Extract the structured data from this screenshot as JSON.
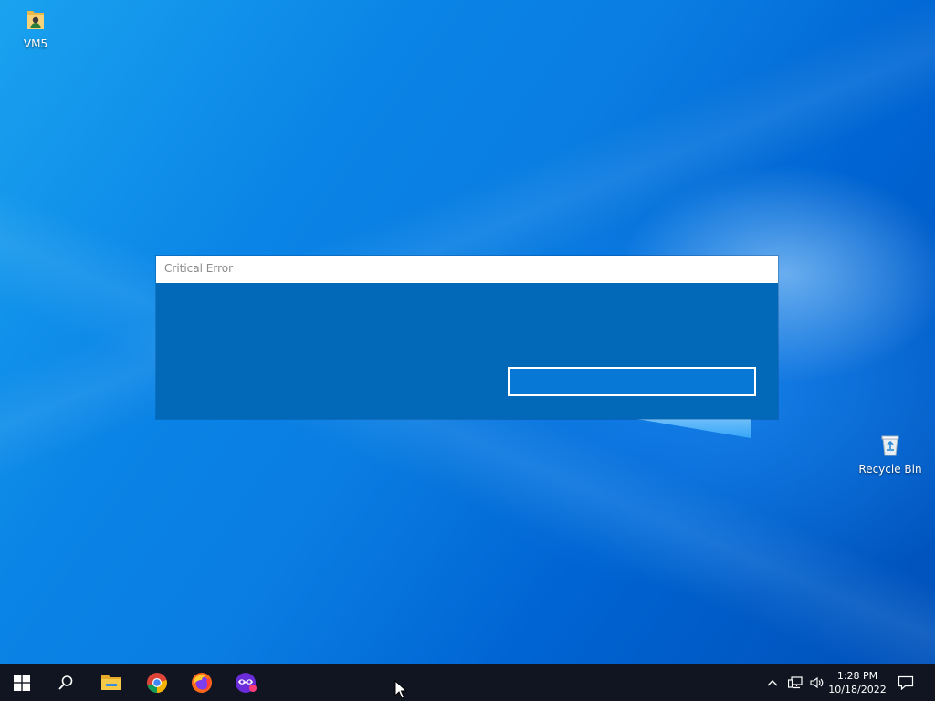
{
  "desktop": {
    "icons": [
      {
        "label": "VM5",
        "icon": "user-folder-icon"
      },
      {
        "label": "Recycle Bin",
        "icon": "recycle-bin-icon"
      }
    ]
  },
  "dialog": {
    "title": "Critical Error",
    "button_label": ""
  },
  "taskbar": {
    "items": [
      "start-icon",
      "search-icon",
      "file-explorer-icon",
      "chrome-icon",
      "firefox-icon",
      "app-icon"
    ],
    "tray": {
      "time": "1:28 PM",
      "date": "10/18/2022"
    }
  },
  "colors": {
    "taskbar": "#101521",
    "dialog_body": "#0169b8",
    "dialog_button": "#0878d6"
  }
}
